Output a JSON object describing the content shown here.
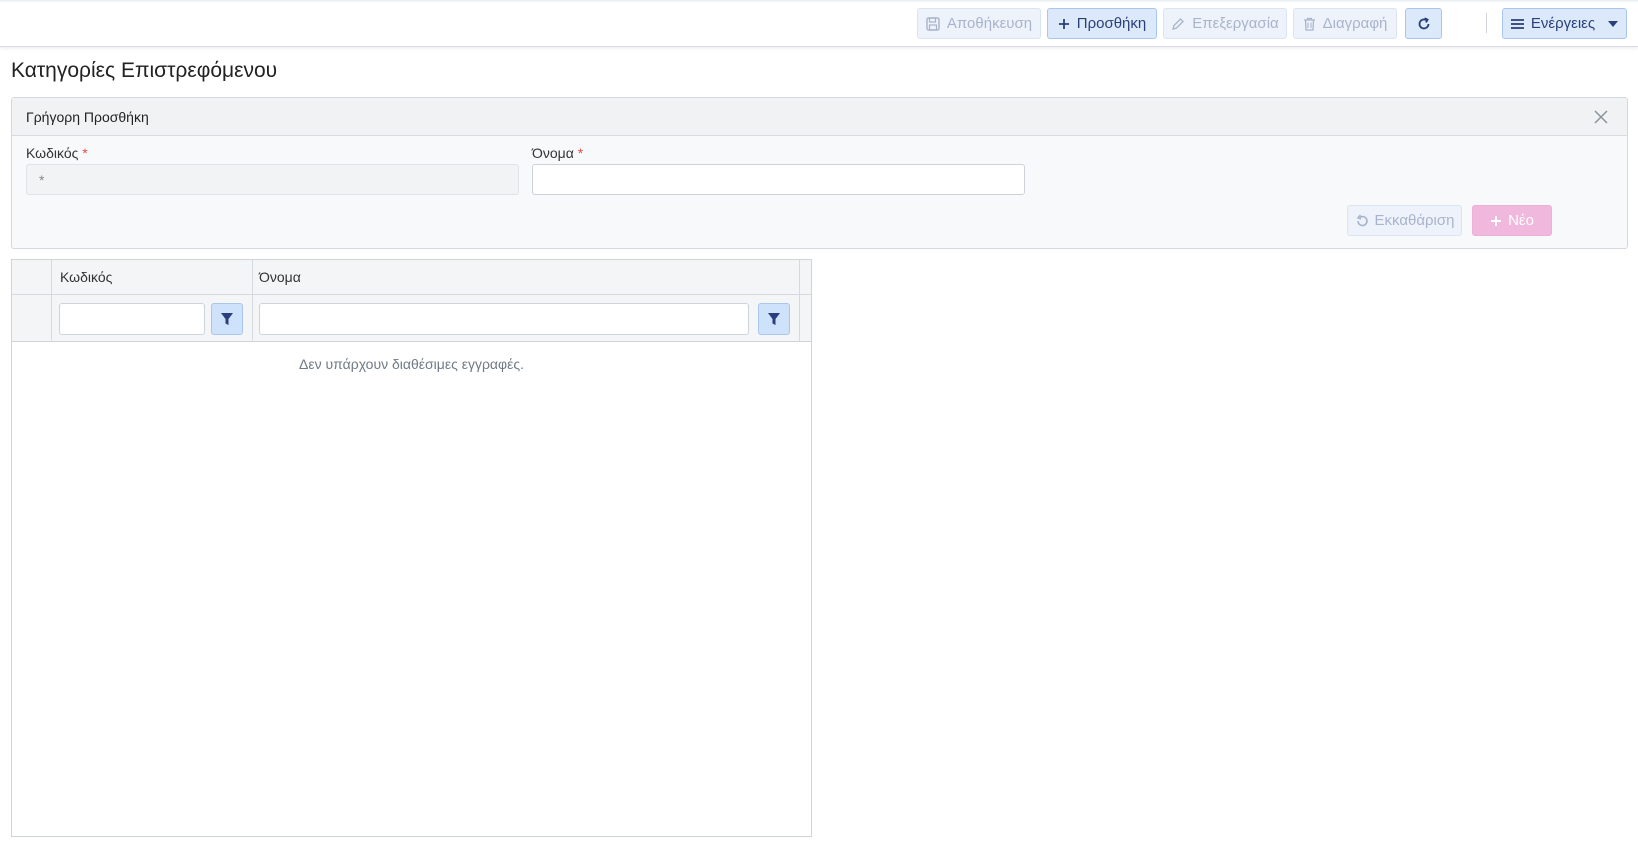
{
  "toolbar": {
    "save_label": "Αποθήκευση",
    "add_label": "Προσθήκη",
    "edit_label": "Επεξεργασία",
    "delete_label": "Διαγραφή",
    "actions_label": "Ενέργειες"
  },
  "page": {
    "title": "Κατηγορίες Επιστρεφόμενου"
  },
  "quick_add": {
    "title": "Γρήγορη Προσθήκη",
    "code_label": "Κωδικός",
    "code_value": "*",
    "name_label": "Όνομα",
    "name_value": "",
    "required_mark": "*",
    "clear_label": "Εκκαθάριση",
    "new_label": "Νέο"
  },
  "grid": {
    "columns": [
      "Κωδικός",
      "Όνομα"
    ],
    "empty_message": "Δεν υπάρχουν διαθέσιμες εγγραφές."
  },
  "colors": {
    "accent": "#2b3f7a",
    "active_button_bg": "#dbe9fb",
    "new_button_bg": "#f0b8dc",
    "required": "#e34b4b"
  }
}
